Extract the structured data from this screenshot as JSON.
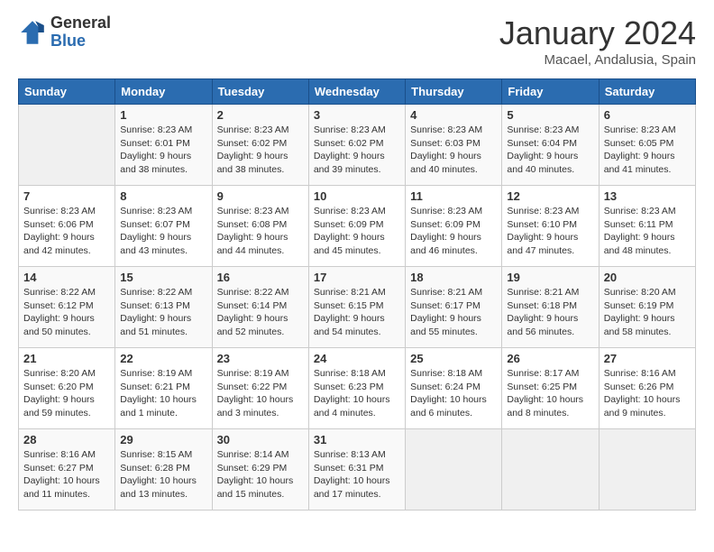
{
  "logo": {
    "line1": "General",
    "line2": "Blue"
  },
  "title": "January 2024",
  "subtitle": "Macael, Andalusia, Spain",
  "days_of_week": [
    "Sunday",
    "Monday",
    "Tuesday",
    "Wednesday",
    "Thursday",
    "Friday",
    "Saturday"
  ],
  "weeks": [
    [
      {
        "day": "",
        "info": ""
      },
      {
        "day": "1",
        "info": "Sunrise: 8:23 AM\nSunset: 6:01 PM\nDaylight: 9 hours and 38 minutes."
      },
      {
        "day": "2",
        "info": "Sunrise: 8:23 AM\nSunset: 6:02 PM\nDaylight: 9 hours and 38 minutes."
      },
      {
        "day": "3",
        "info": "Sunrise: 8:23 AM\nSunset: 6:02 PM\nDaylight: 9 hours and 39 minutes."
      },
      {
        "day": "4",
        "info": "Sunrise: 8:23 AM\nSunset: 6:03 PM\nDaylight: 9 hours and 40 minutes."
      },
      {
        "day": "5",
        "info": "Sunrise: 8:23 AM\nSunset: 6:04 PM\nDaylight: 9 hours and 40 minutes."
      },
      {
        "day": "6",
        "info": "Sunrise: 8:23 AM\nSunset: 6:05 PM\nDaylight: 9 hours and 41 minutes."
      }
    ],
    [
      {
        "day": "7",
        "info": "Sunrise: 8:23 AM\nSunset: 6:06 PM\nDaylight: 9 hours and 42 minutes."
      },
      {
        "day": "8",
        "info": "Sunrise: 8:23 AM\nSunset: 6:07 PM\nDaylight: 9 hours and 43 minutes."
      },
      {
        "day": "9",
        "info": "Sunrise: 8:23 AM\nSunset: 6:08 PM\nDaylight: 9 hours and 44 minutes."
      },
      {
        "day": "10",
        "info": "Sunrise: 8:23 AM\nSunset: 6:09 PM\nDaylight: 9 hours and 45 minutes."
      },
      {
        "day": "11",
        "info": "Sunrise: 8:23 AM\nSunset: 6:09 PM\nDaylight: 9 hours and 46 minutes."
      },
      {
        "day": "12",
        "info": "Sunrise: 8:23 AM\nSunset: 6:10 PM\nDaylight: 9 hours and 47 minutes."
      },
      {
        "day": "13",
        "info": "Sunrise: 8:23 AM\nSunset: 6:11 PM\nDaylight: 9 hours and 48 minutes."
      }
    ],
    [
      {
        "day": "14",
        "info": "Sunrise: 8:22 AM\nSunset: 6:12 PM\nDaylight: 9 hours and 50 minutes."
      },
      {
        "day": "15",
        "info": "Sunrise: 8:22 AM\nSunset: 6:13 PM\nDaylight: 9 hours and 51 minutes."
      },
      {
        "day": "16",
        "info": "Sunrise: 8:22 AM\nSunset: 6:14 PM\nDaylight: 9 hours and 52 minutes."
      },
      {
        "day": "17",
        "info": "Sunrise: 8:21 AM\nSunset: 6:15 PM\nDaylight: 9 hours and 54 minutes."
      },
      {
        "day": "18",
        "info": "Sunrise: 8:21 AM\nSunset: 6:17 PM\nDaylight: 9 hours and 55 minutes."
      },
      {
        "day": "19",
        "info": "Sunrise: 8:21 AM\nSunset: 6:18 PM\nDaylight: 9 hours and 56 minutes."
      },
      {
        "day": "20",
        "info": "Sunrise: 8:20 AM\nSunset: 6:19 PM\nDaylight: 9 hours and 58 minutes."
      }
    ],
    [
      {
        "day": "21",
        "info": "Sunrise: 8:20 AM\nSunset: 6:20 PM\nDaylight: 9 hours and 59 minutes."
      },
      {
        "day": "22",
        "info": "Sunrise: 8:19 AM\nSunset: 6:21 PM\nDaylight: 10 hours and 1 minute."
      },
      {
        "day": "23",
        "info": "Sunrise: 8:19 AM\nSunset: 6:22 PM\nDaylight: 10 hours and 3 minutes."
      },
      {
        "day": "24",
        "info": "Sunrise: 8:18 AM\nSunset: 6:23 PM\nDaylight: 10 hours and 4 minutes."
      },
      {
        "day": "25",
        "info": "Sunrise: 8:18 AM\nSunset: 6:24 PM\nDaylight: 10 hours and 6 minutes."
      },
      {
        "day": "26",
        "info": "Sunrise: 8:17 AM\nSunset: 6:25 PM\nDaylight: 10 hours and 8 minutes."
      },
      {
        "day": "27",
        "info": "Sunrise: 8:16 AM\nSunset: 6:26 PM\nDaylight: 10 hours and 9 minutes."
      }
    ],
    [
      {
        "day": "28",
        "info": "Sunrise: 8:16 AM\nSunset: 6:27 PM\nDaylight: 10 hours and 11 minutes."
      },
      {
        "day": "29",
        "info": "Sunrise: 8:15 AM\nSunset: 6:28 PM\nDaylight: 10 hours and 13 minutes."
      },
      {
        "day": "30",
        "info": "Sunrise: 8:14 AM\nSunset: 6:29 PM\nDaylight: 10 hours and 15 minutes."
      },
      {
        "day": "31",
        "info": "Sunrise: 8:13 AM\nSunset: 6:31 PM\nDaylight: 10 hours and 17 minutes."
      },
      {
        "day": "",
        "info": ""
      },
      {
        "day": "",
        "info": ""
      },
      {
        "day": "",
        "info": ""
      }
    ]
  ]
}
